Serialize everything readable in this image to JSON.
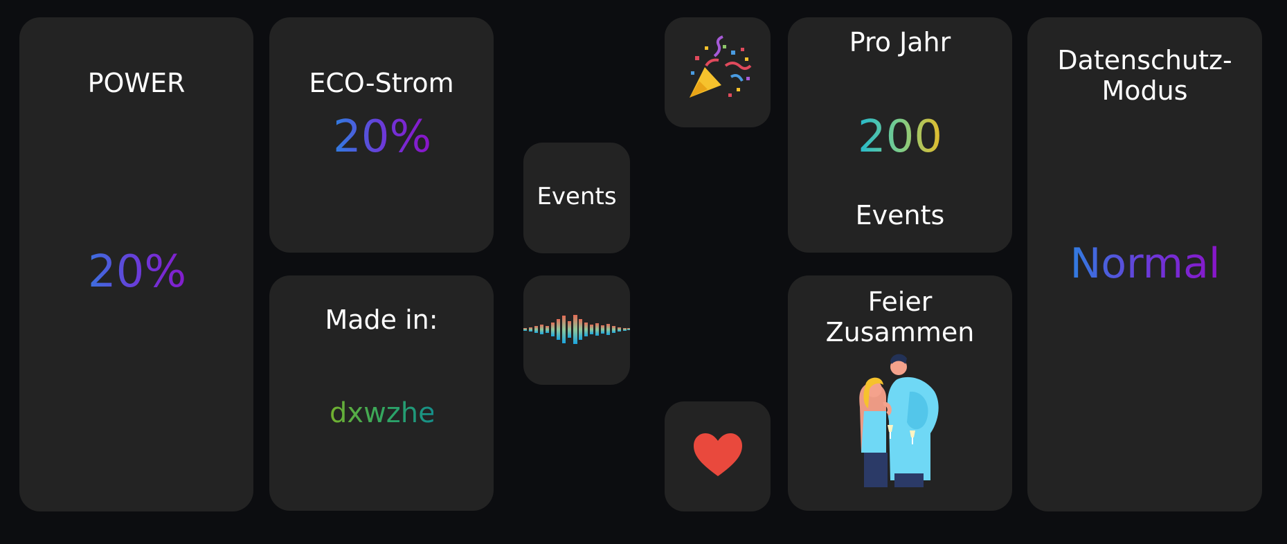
{
  "tiles": {
    "power": {
      "label": "POWER",
      "value": "20%"
    },
    "eco": {
      "label": "ECO-Strom",
      "value": "20%"
    },
    "events_small": {
      "label": "Events"
    },
    "made_in": {
      "label": "Made in:",
      "value": "dxwzhe"
    },
    "pro_jahr": {
      "label": "Pro Jahr",
      "value": "200",
      "sub": "Events"
    },
    "feier": {
      "label_line1": "Feier",
      "label_line2": "Zusammen"
    },
    "datenschutz": {
      "label_line1": "Datenschutz-",
      "label_line2": "Modus",
      "value": "Normal"
    }
  },
  "icons": {
    "party": "party-popper-icon",
    "waveform": "waveform-icon",
    "heart": "heart-icon",
    "couple": "couple-illustration"
  },
  "colors": {
    "background": "#0c0d10",
    "tile": "#232323",
    "heart": "#e9493d"
  }
}
